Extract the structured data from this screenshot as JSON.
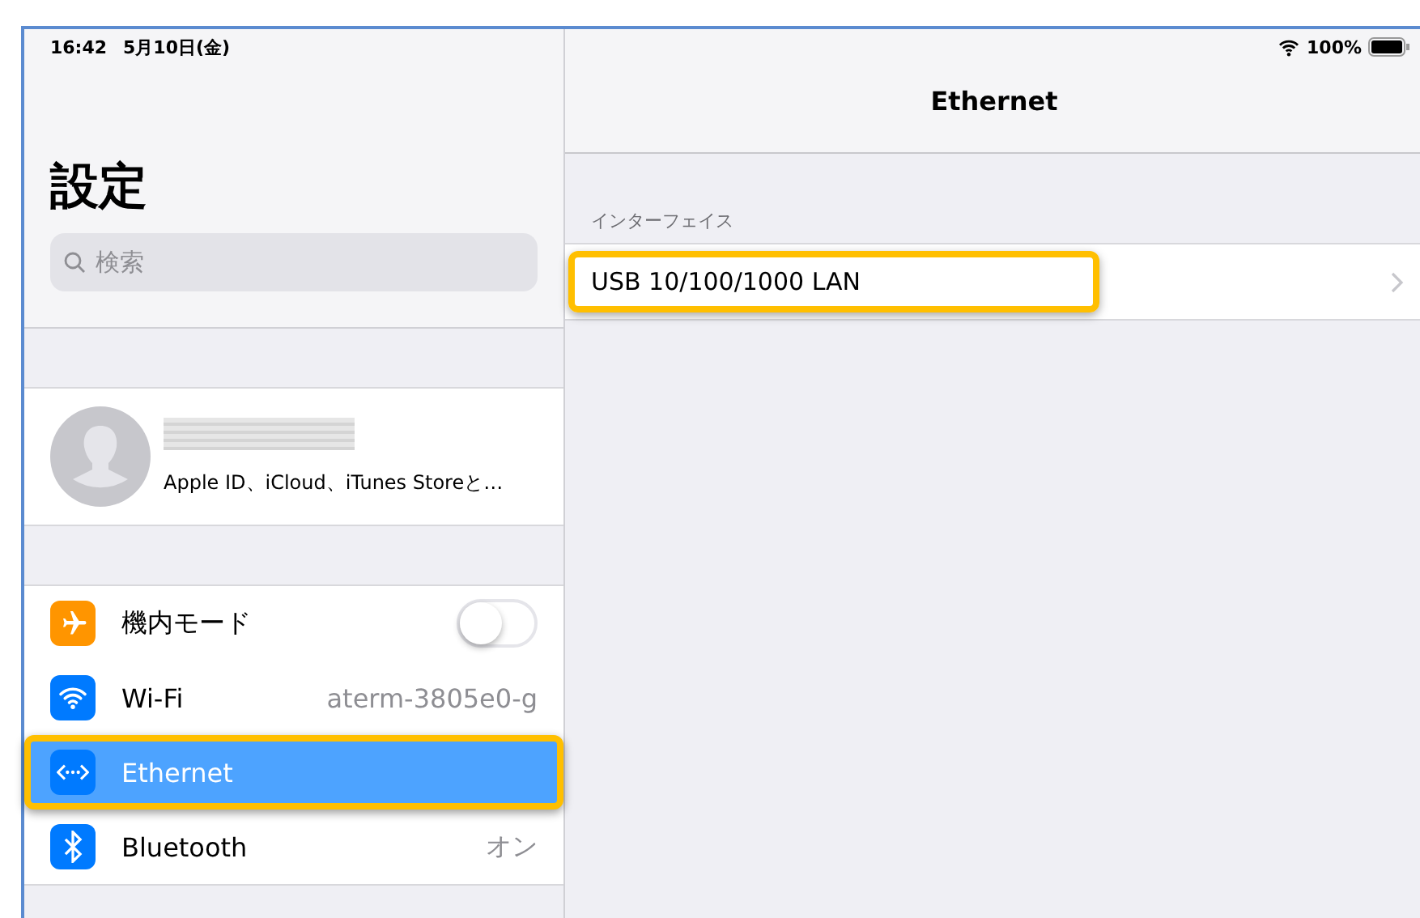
{
  "status_bar": {
    "time": "16:42",
    "date": "5月10日(金)",
    "battery": "100%"
  },
  "sidebar": {
    "title": "設定",
    "search": {
      "placeholder": "検索"
    },
    "profile": {
      "subtitle": "Apple ID、iCloud、iTunes Storeと…"
    },
    "items": [
      {
        "kind": "toggle",
        "color": "#ff9500",
        "label": "機内モード",
        "on": false,
        "selected": false,
        "highlighted": false
      },
      {
        "kind": "value",
        "color": "#007aff",
        "label": "Wi-Fi",
        "value": "aterm-3805e0-g",
        "selected": false,
        "highlighted": false
      },
      {
        "kind": "plain",
        "color": "#007aff",
        "label": "Ethernet",
        "selected": true,
        "highlighted": true
      },
      {
        "kind": "value",
        "color": "#007aff",
        "label": "Bluetooth",
        "value": "オン",
        "selected": false,
        "highlighted": false
      }
    ]
  },
  "detail": {
    "title": "Ethernet",
    "section_header": "インターフェイス",
    "rows": [
      {
        "label": "USB 10/100/1000 LAN",
        "highlighted": true
      }
    ]
  }
}
